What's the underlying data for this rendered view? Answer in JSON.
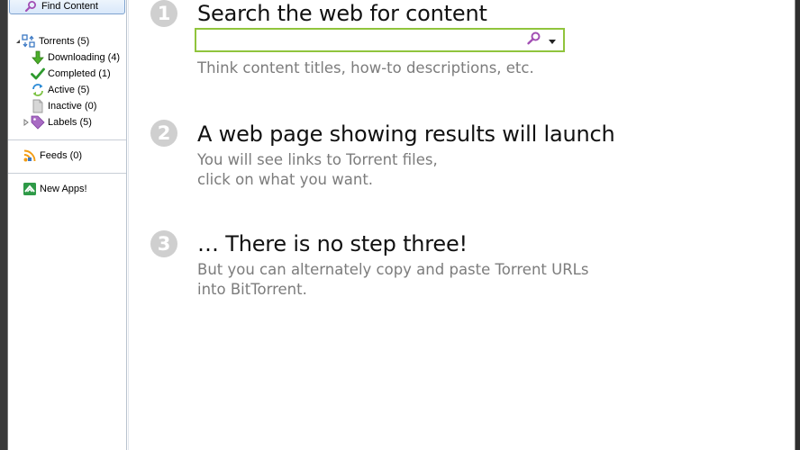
{
  "sidebar": {
    "find_content": {
      "label": "Find Content",
      "icon": "search-icon"
    },
    "tree": [
      {
        "id": "torrents",
        "label": "Torrents (5)",
        "icon": "torrents-icon",
        "expanded": true
      },
      {
        "id": "downloading",
        "label": "Downloading (4)",
        "icon": "download-arrow-icon",
        "color": "#4caf2a"
      },
      {
        "id": "completed",
        "label": "Completed (1)",
        "icon": "checkmark-icon",
        "color": "#2e9a2e"
      },
      {
        "id": "active",
        "label": "Active (5)",
        "icon": "refresh-arrows-icon",
        "color": "#2a8ad6"
      },
      {
        "id": "inactive",
        "label": "Inactive (0)",
        "icon": "inactive-doc-icon",
        "color": "#9a9a9a"
      },
      {
        "id": "labels",
        "label": "Labels (5)",
        "icon": "tag-icon",
        "color": "#9b59b6",
        "expanded": false
      }
    ],
    "feeds": {
      "label": "Feeds (0)",
      "icon": "rss-feed-icon",
      "color": "#f39c12"
    },
    "apps": {
      "label": "New Apps!",
      "icon": "apps-icon",
      "color": "#2e9a47"
    }
  },
  "main": {
    "steps": [
      {
        "number": "1",
        "title": "Search the web for content",
        "description_lines": [
          "Think content titles, how-to descriptions, etc."
        ]
      },
      {
        "number": "2",
        "title": "A web page showing results will launch",
        "description_lines": [
          "You will see links to Torrent files,",
          "click on what you want."
        ]
      },
      {
        "number": "3",
        "title": "… There is no step three!",
        "description_lines": [
          "But you can alternately copy and paste Torrent URLs",
          "into BitTorrent."
        ]
      }
    ],
    "search": {
      "value": "",
      "placeholder": "",
      "accent_color": "#90c43c"
    }
  }
}
